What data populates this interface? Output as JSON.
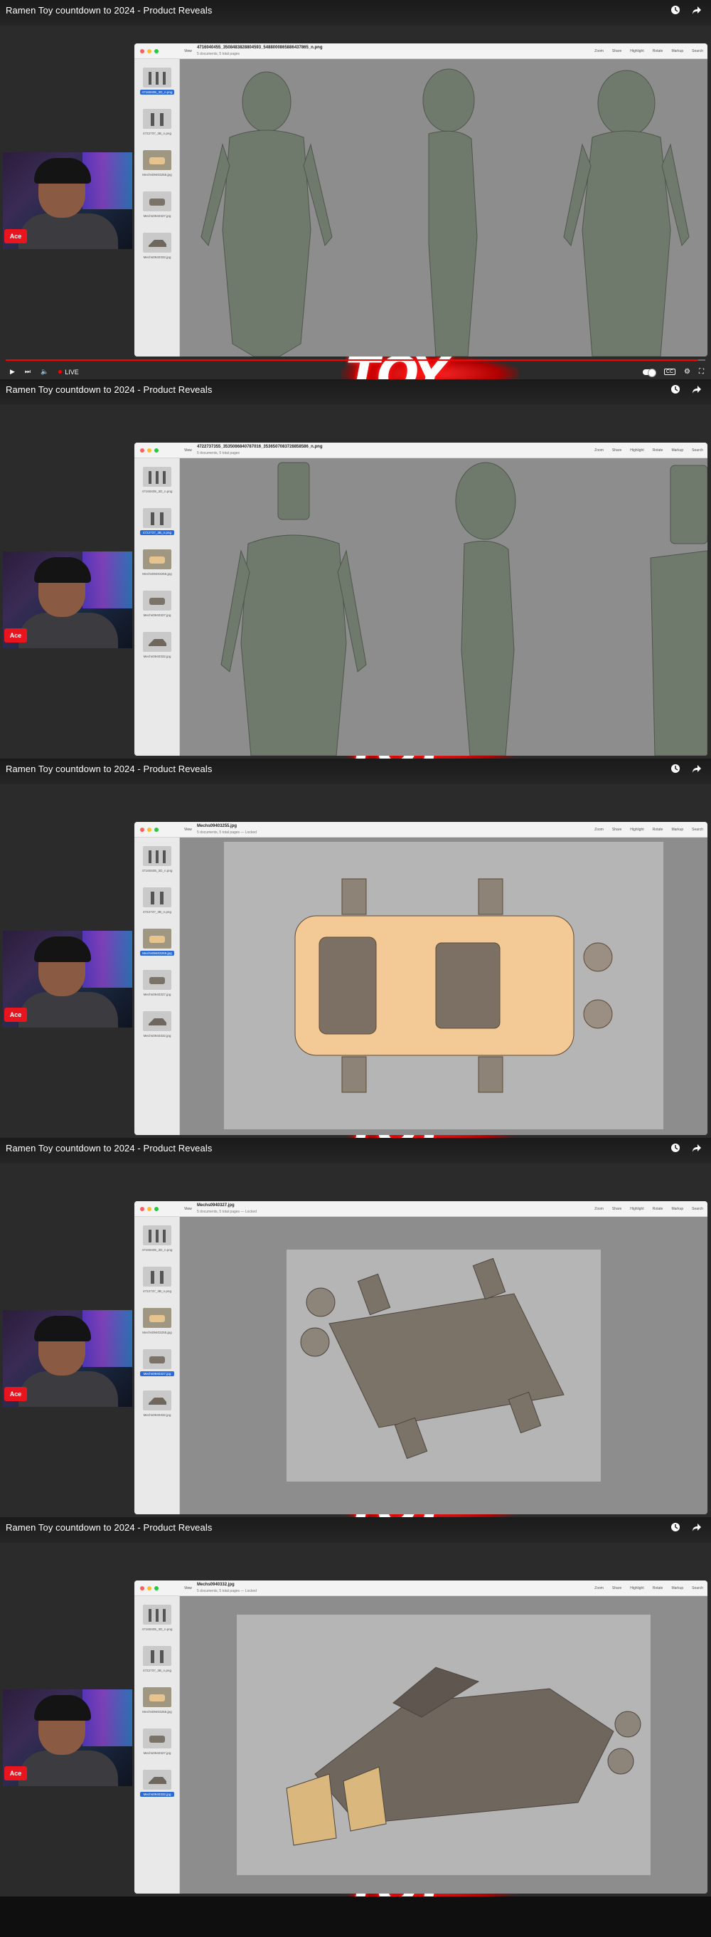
{
  "video": {
    "title": "Ramen Toy countdown to 2024 - Product Reveals",
    "live_label": "LIVE",
    "brand_word": "TOY"
  },
  "webcam": {
    "badge": "Ace"
  },
  "viewer": {
    "view_label": "View",
    "tools": [
      "Zoom",
      "Share",
      "Highlight",
      "Rotate",
      "Markup",
      "Search"
    ],
    "thumbs": [
      "47160405_3D_n.png",
      "4722737_3B_n.png",
      "Mechs09403255.jpg",
      "Mechs0940327.jpg",
      "Mechs0940332.jpg"
    ]
  },
  "frames": [
    {
      "doc_title": "4716040455_3508483828804593_5488000865886437865_n.png",
      "doc_sub": "5 documents, 5 total pages",
      "selected": 0
    },
    {
      "doc_title": "4722737355_3535086840787016_3536507083728858586_n.png",
      "doc_sub": "5 documents, 5 total pages",
      "selected": 1
    },
    {
      "doc_title": "Mechs09403255.jpg",
      "doc_sub": "5 documents, 5 total pages — Locked",
      "selected": 2
    },
    {
      "doc_title": "Mechs0940327.jpg",
      "doc_sub": "5 documents, 5 total pages — Locked",
      "selected": 3
    },
    {
      "doc_title": "Mechs0940332.jpg",
      "doc_sub": "5 documents, 5 total pages — Locked",
      "selected": 4
    }
  ],
  "colors": {
    "accent": "#ff0000",
    "selection": "#2a6bd8",
    "sculpt": "#6f7a6c",
    "car_top": "#f3c996",
    "car_under": "#7b7268"
  }
}
